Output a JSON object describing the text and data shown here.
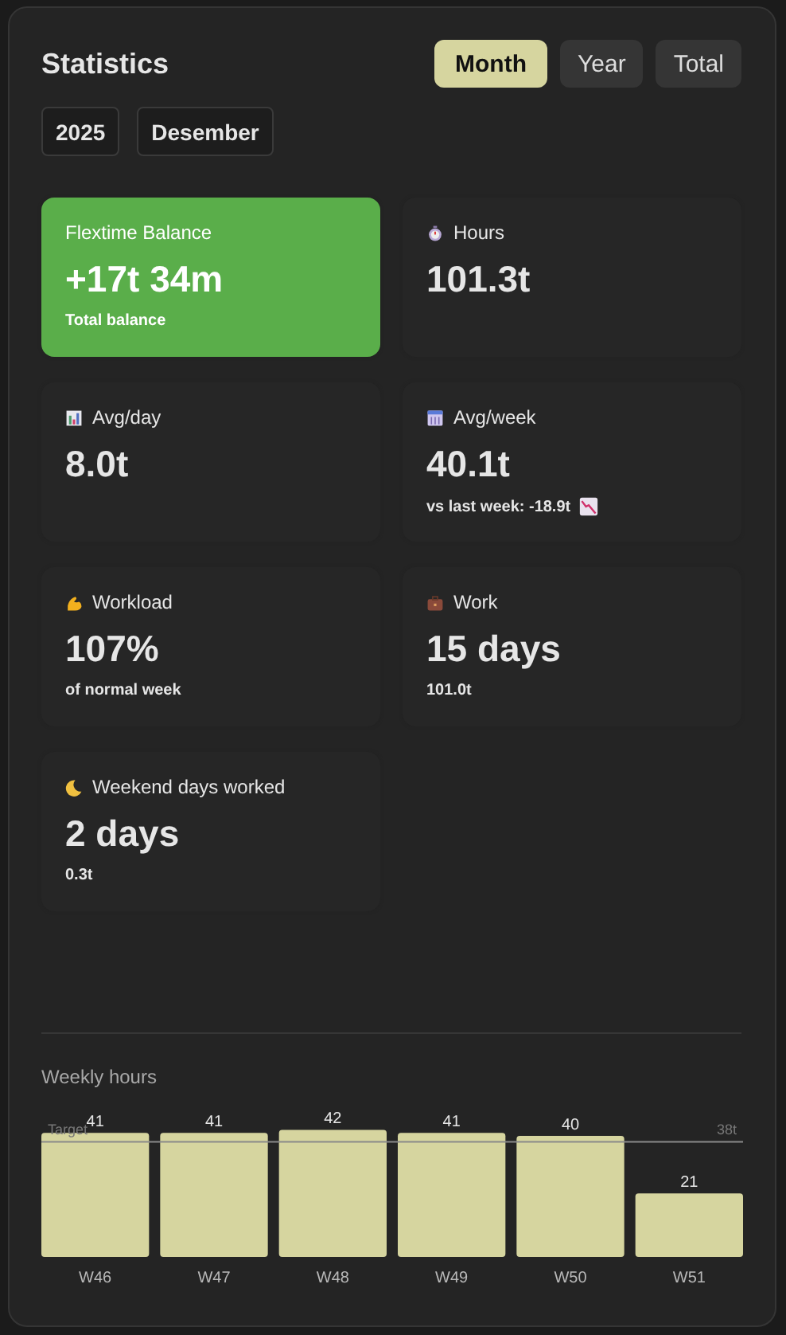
{
  "title": "Statistics",
  "periods": [
    {
      "label": "Month",
      "selected": true
    },
    {
      "label": "Year",
      "selected": false
    },
    {
      "label": "Total",
      "selected": false
    }
  ],
  "filters": [
    {
      "label": "2025"
    },
    {
      "label": "Desember"
    }
  ],
  "cards": [
    {
      "kind": "balance",
      "highlight": true,
      "label": "Flextime Balance",
      "value": "+17t 34m",
      "note": "Total balance"
    },
    {
      "kind": "hours",
      "highlight": false,
      "label": "Hours",
      "value": "101.3t"
    },
    {
      "kind": "avg_day",
      "highlight": false,
      "label": "Avg/day",
      "value": "8.0t"
    },
    {
      "kind": "avg_week",
      "highlight": false,
      "label": "Avg/week",
      "value": "40.1t",
      "note": "vs last week: -18.9t",
      "falling": true
    },
    {
      "kind": "workload",
      "highlight": false,
      "label": "Workload",
      "value": "107%",
      "note": "of normal week"
    },
    {
      "kind": "work",
      "highlight": false,
      "label": "Work",
      "value": "15 days",
      "note": "101.0t"
    },
    {
      "kind": "weekend",
      "highlight": false,
      "label": "Weekend days worked",
      "value": "2 days",
      "note": "0.3t"
    }
  ],
  "weekly": {
    "title": "Weekly hours",
    "chart_data": {
      "type": "bar",
      "categories": [
        "W46",
        "W47",
        "W48",
        "W49",
        "W50",
        "W51"
      ],
      "series": [
        {
          "color": "#d6d59f",
          "values": [
            41,
            41,
            42,
            41,
            40,
            21
          ]
        }
      ],
      "data_labels": true
    },
    "target": {
      "caption": "Target",
      "reading": "38t"
    }
  }
}
